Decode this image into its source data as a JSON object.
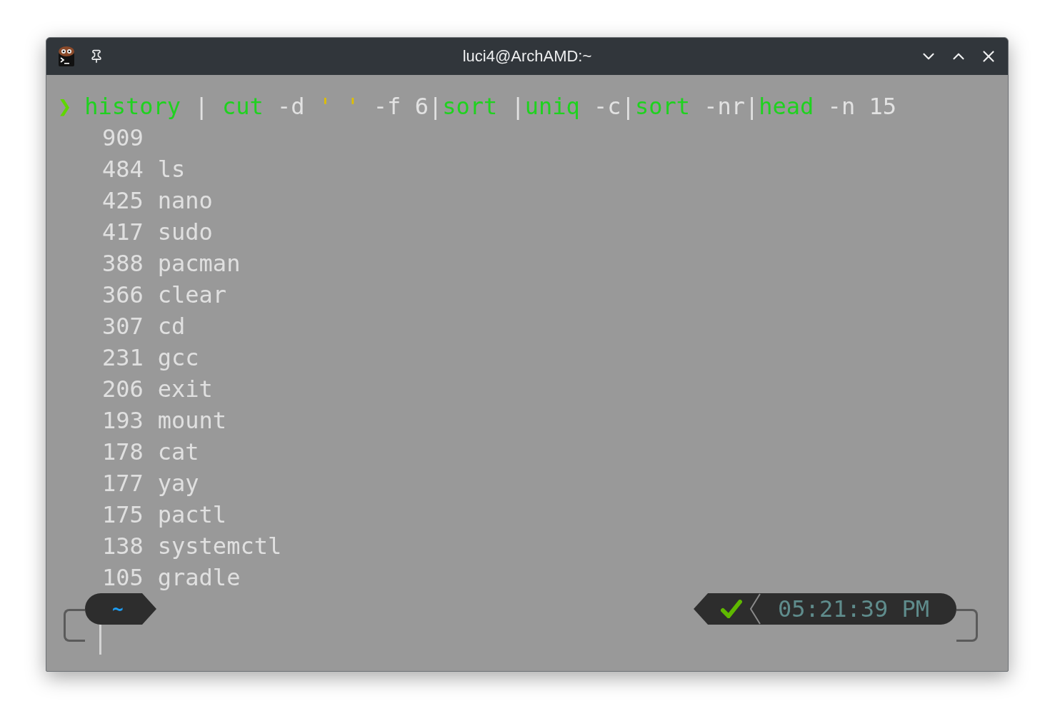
{
  "window": {
    "title": "luci4@ArchAMD:~"
  },
  "command": {
    "prompt_symbol": "❯",
    "tokens": [
      {
        "text": "history",
        "kind": "command"
      },
      {
        "text": " | ",
        "kind": "plain"
      },
      {
        "text": "cut",
        "kind": "command"
      },
      {
        "text": " -d ",
        "kind": "plain"
      },
      {
        "text": "' '",
        "kind": "quote"
      },
      {
        "text": " -f 6|",
        "kind": "plain"
      },
      {
        "text": "sort",
        "kind": "command"
      },
      {
        "text": " |",
        "kind": "plain"
      },
      {
        "text": "uniq",
        "kind": "command"
      },
      {
        "text": " -c|",
        "kind": "plain"
      },
      {
        "text": "sort",
        "kind": "command"
      },
      {
        "text": " -nr|",
        "kind": "plain"
      },
      {
        "text": "head",
        "kind": "command"
      },
      {
        "text": " -n 15",
        "kind": "plain"
      }
    ]
  },
  "output": [
    {
      "count": "909"
    },
    {
      "count": "484",
      "name": "ls"
    },
    {
      "count": "425",
      "name": "nano"
    },
    {
      "count": "417",
      "name": "sudo"
    },
    {
      "count": "388",
      "name": "pacman"
    },
    {
      "count": "366",
      "name": "clear"
    },
    {
      "count": "307",
      "name": "cd"
    },
    {
      "count": "231",
      "name": "gcc"
    },
    {
      "count": "206",
      "name": "exit"
    },
    {
      "count": "193",
      "name": "mount"
    },
    {
      "count": "178",
      "name": "cat"
    },
    {
      "count": "177",
      "name": "yay"
    },
    {
      "count": "175",
      "name": "pactl"
    },
    {
      "count": "138",
      "name": "systemctl"
    },
    {
      "count": "105",
      "name": "gradle"
    }
  ],
  "prompt": {
    "directory": "~",
    "last_command_ok": true,
    "time": "05:21:39 PM"
  }
}
